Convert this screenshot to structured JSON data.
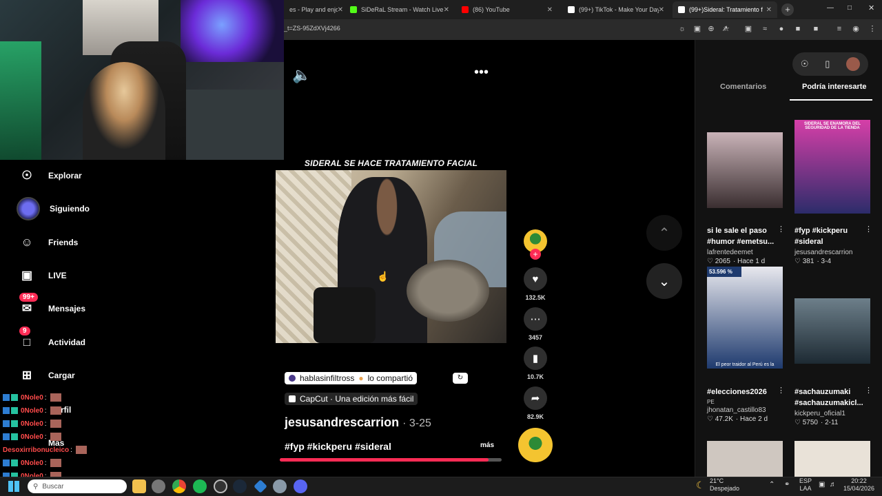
{
  "browser": {
    "tabs": [
      {
        "title": "es - Play and enjoy",
        "active": false,
        "favicon_color": "#555555"
      },
      {
        "title": "SiDeRaL Stream - Watch Live o",
        "active": false,
        "favicon_color": "#53fc18"
      },
      {
        "title": "(86) YouTube",
        "active": false,
        "favicon_color": "#ff0000"
      },
      {
        "title": "(99+) TikTok - Make Your Day",
        "active": false,
        "favicon_color": "#ffffff"
      },
      {
        "title": "(99+)Sideral: Tratamiento f",
        "active": true,
        "favicon_color": "#ffffff"
      }
    ],
    "url": "_t=ZS-95ZdXVj4266"
  },
  "sidebar": {
    "items": [
      {
        "label": "Explorar",
        "icon": "compass-icon",
        "glyph": "☉"
      },
      {
        "label": "Siguiendo",
        "icon": "avatar",
        "glyph": ""
      },
      {
        "label": "Friends",
        "icon": "friends-icon",
        "glyph": "☺"
      },
      {
        "label": "LIVE",
        "icon": "live-tv-icon",
        "glyph": "▣"
      },
      {
        "label": "Mensajes",
        "icon": "messages-icon",
        "glyph": "✉",
        "badge": "99+"
      },
      {
        "label": "Actividad",
        "icon": "activity-icon",
        "glyph": "□",
        "badge": "9"
      },
      {
        "label": "Cargar",
        "icon": "upload-icon",
        "glyph": "⊞"
      }
    ],
    "partial": {
      "perfil": "rfil",
      "mas": "Más"
    }
  },
  "chat": {
    "lines": [
      {
        "name": "0Nole0",
        "sep": ":"
      },
      {
        "name": "0Nole0",
        "sep": ":"
      },
      {
        "name": "0Nole0",
        "sep": ":"
      },
      {
        "name": "0Nole0",
        "sep": ":"
      },
      {
        "name": "Desoxirribonucleico",
        "sep": ":"
      },
      {
        "name": "0Nole0",
        "sep": ":"
      },
      {
        "name": "0Nole0",
        "sep": ":"
      },
      {
        "name": "0Nole0",
        "sep": ":"
      }
    ]
  },
  "video": {
    "overlay_title": "SIDERAL SE HACE TRATAMIENTO FACIAL",
    "shared_by": "hablasinfiltross",
    "shared_suffix": "lo compartió",
    "capcut": "CapCut · Una edición más fácil",
    "author": "jesusandrescarrion",
    "date": "· 3-25",
    "hashtags": "#fyp #kickperu #sideral",
    "more": "más",
    "progress": 0.94,
    "likes": "132.5K",
    "comments": "3457",
    "saves": "10.7K",
    "shares": "82.9K"
  },
  "panel": {
    "tab_comments": "Comentarios",
    "tab_interest": "Podría interesarte",
    "cards": [
      {
        "title": "si le sale el paso #humor #emetsu...",
        "author": "lafrentedeemet",
        "likes": "2065",
        "age": "· Hace 1 d",
        "thumb_top": "#c9b3b8",
        "thumb_bottom": "#3a2e30",
        "caption": "",
        "top_caption": ""
      },
      {
        "title": "#fyp #kickperu #sideral",
        "author": "jesusandrescarrion",
        "likes": "381",
        "age": "· 3-4",
        "thumb_top": "#d63fa8",
        "thumb_bottom": "#2c2c6a",
        "caption": "",
        "top_caption": "SIDERAL SE ENAMORA DEL SEGURIDAD DE LA TIENDA"
      },
      {
        "title": "#elecciones2026",
        "author": "jhonatan_castillo83",
        "likes": "47.2K",
        "age": "· Hace 2 d",
        "thumb_top": "#e8e8ee",
        "thumb_bottom": "#1e3a6e",
        "caption": "El peor traidor al Perú es la",
        "top_caption": "53.596 %",
        "sub": "PE"
      },
      {
        "title": "#sachauzumaki #sachauzumakicl...",
        "author": "kickperu_oficial1",
        "likes": "5750",
        "age": "· 2-11",
        "thumb_top": "#6d7f8a",
        "thumb_bottom": "#1d2a33",
        "caption": "",
        "top_caption": ""
      }
    ]
  },
  "taskbar": {
    "search_placeholder": "Buscar",
    "weather_temp": "21°C",
    "weather_desc": "Despejado",
    "lang": "ESP",
    "layout": "LAA",
    "time": "20:22",
    "date": "15/04/2026"
  }
}
